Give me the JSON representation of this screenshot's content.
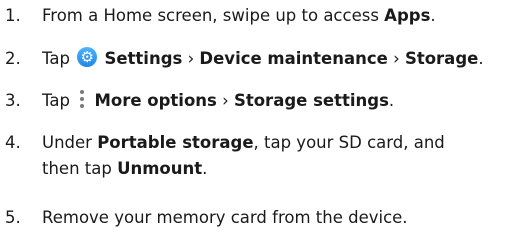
{
  "steps": [
    {
      "number": "1.",
      "pre": "From a Home screen, swipe up to access ",
      "bold": "Apps",
      "post": "."
    },
    {
      "number": "2.",
      "pre": "Tap",
      "icon": "settings-gear-icon",
      "bold": "Settings",
      "sep1": " › ",
      "bold2": "Device maintenance",
      "sep2": " › ",
      "bold3": "Storage",
      "post": "."
    },
    {
      "number": "3.",
      "pre": "Tap",
      "icon": "more-options-kebab-icon",
      "bold": "More options",
      "sep1": " › ",
      "bold2": "Storage settings",
      "post": "."
    },
    {
      "number": "4.",
      "pre": "Under ",
      "bold": "Portable storage",
      "mid": ", tap your SD card, and",
      "line2_pre": "then tap ",
      "bold2": "Unmount",
      "post": "."
    },
    {
      "number": "5.",
      "text": "Remove your memory card from the device."
    }
  ],
  "colors": {
    "text": "#1a1a1a",
    "settings_icon": "#1e88e5",
    "kebab_icon": "#7a7a7a"
  }
}
